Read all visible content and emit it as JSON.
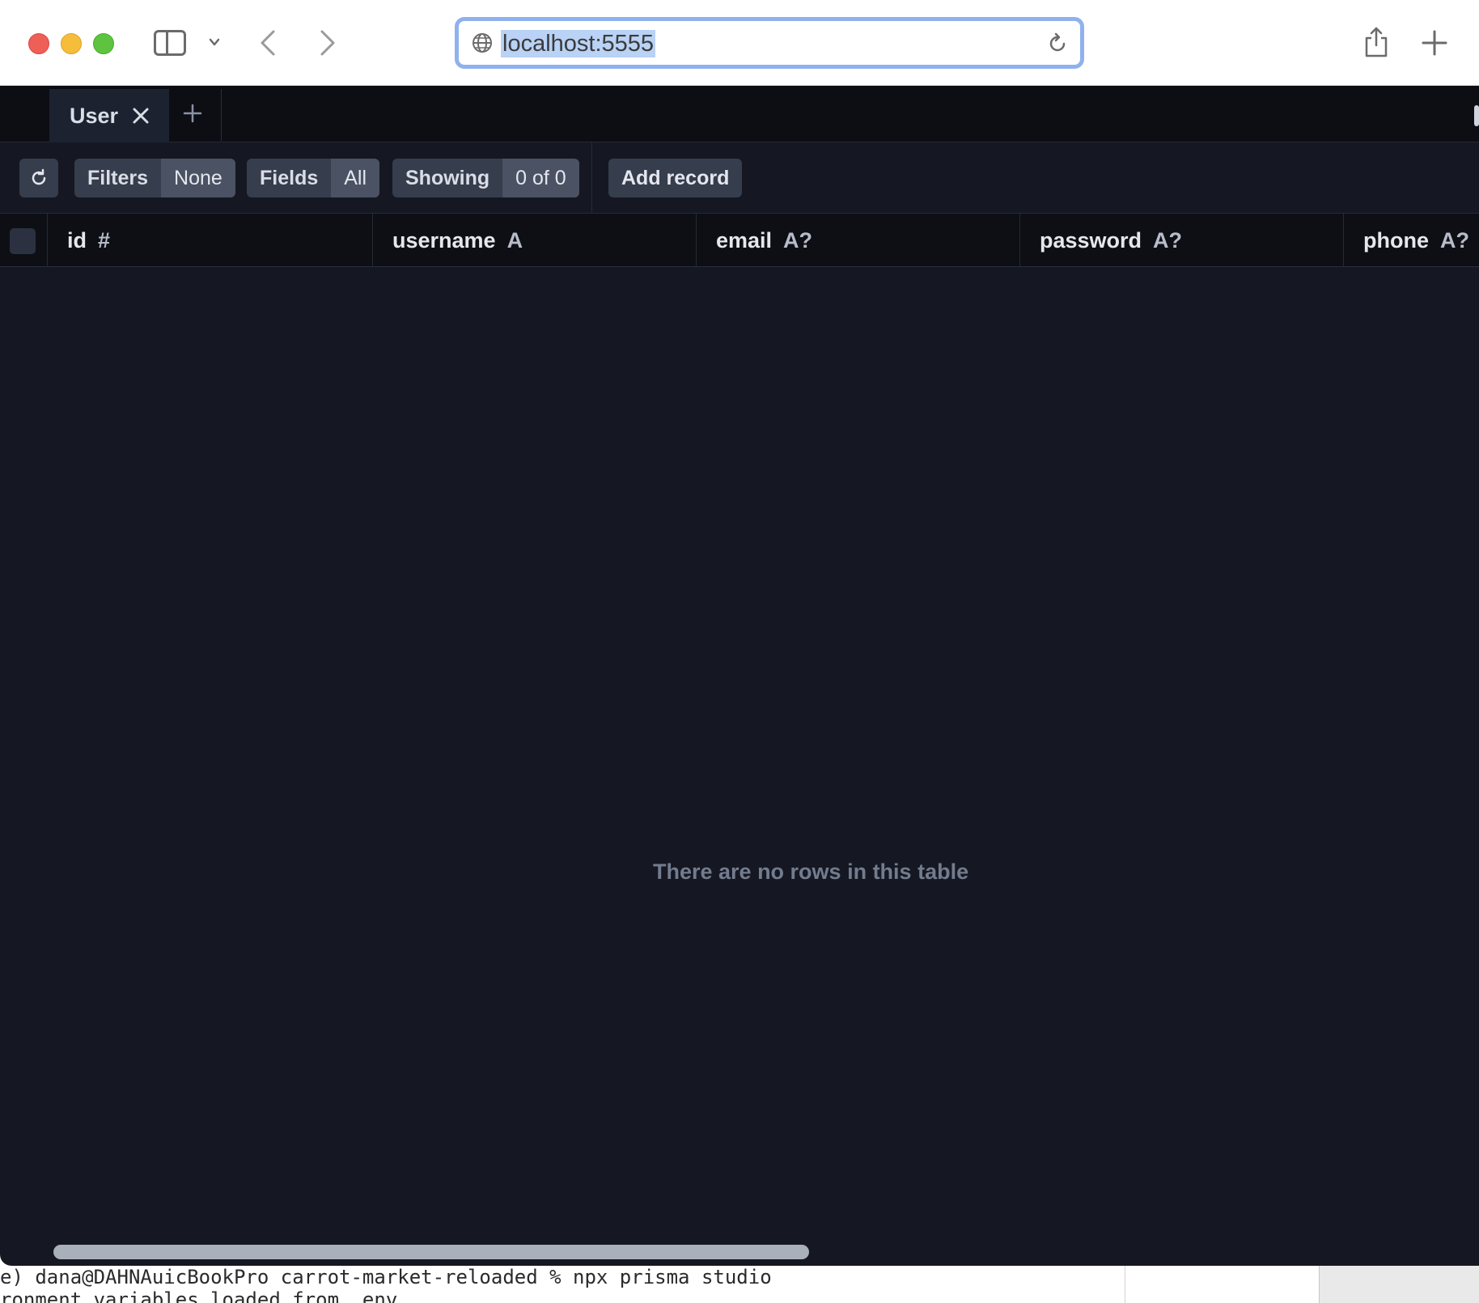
{
  "browser": {
    "url": "localhost:5555"
  },
  "tabs": [
    {
      "label": "User"
    }
  ],
  "toolbar": {
    "filters_label": "Filters",
    "filters_value": "None",
    "fields_label": "Fields",
    "fields_value": "All",
    "showing_label": "Showing",
    "showing_value": "0 of 0",
    "add_record_label": "Add record"
  },
  "columns": [
    {
      "name": "id",
      "type": "#"
    },
    {
      "name": "username",
      "type": "A"
    },
    {
      "name": "email",
      "type": "A?"
    },
    {
      "name": "password",
      "type": "A?"
    },
    {
      "name": "phone",
      "type": "A?"
    }
  ],
  "table": {
    "empty_message": "There are no rows in this table"
  },
  "terminal": {
    "line1": "e) dana@DAHNAuicBookPro carrot-market-reloaded % npx prisma studio",
    "line2": "ronment variables loaded from .env"
  }
}
